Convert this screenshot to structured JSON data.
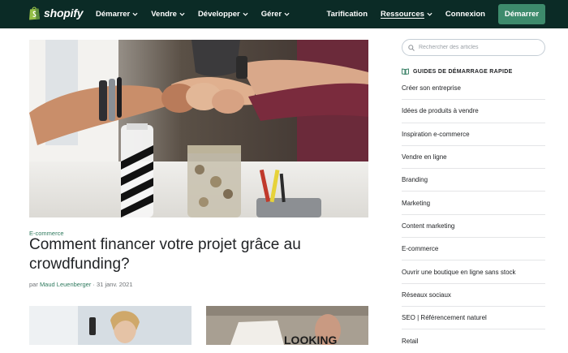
{
  "header": {
    "brand": "shopify",
    "nav_left": [
      {
        "label": "Démarrer"
      },
      {
        "label": "Vendre"
      },
      {
        "label": "Développer"
      },
      {
        "label": "Gérer"
      }
    ],
    "nav_right": {
      "pricing": "Tarification",
      "resources": "Ressources",
      "login": "Connexion",
      "cta": "Démarrer"
    },
    "colors": {
      "background": "#0b2b26",
      "cta": "#3d8b6c"
    }
  },
  "article": {
    "category": "E-commerce",
    "title": "Comment financer votre projet grâce au crowdfunding?",
    "byline_prefix": "par",
    "author": "Maud Leuenberger",
    "separator": "·",
    "date": "31 janv. 2021"
  },
  "sidebar": {
    "search_placeholder": "Rechercher des articles",
    "heading": "GUIDES DE DÉMARRAGE RAPIDE",
    "items": [
      "Créer son entreprise",
      "Idées de produits à vendre",
      "Inspiration e-commerce",
      "Vendre en ligne",
      "Branding",
      "Marketing",
      "Content marketing",
      "E-commerce",
      "Ouvrir une boutique en ligne sans stock",
      "Réseaux sociaux",
      "SEO | Référencement naturel",
      "Retail"
    ]
  },
  "thumb2_text": "LOOKING"
}
